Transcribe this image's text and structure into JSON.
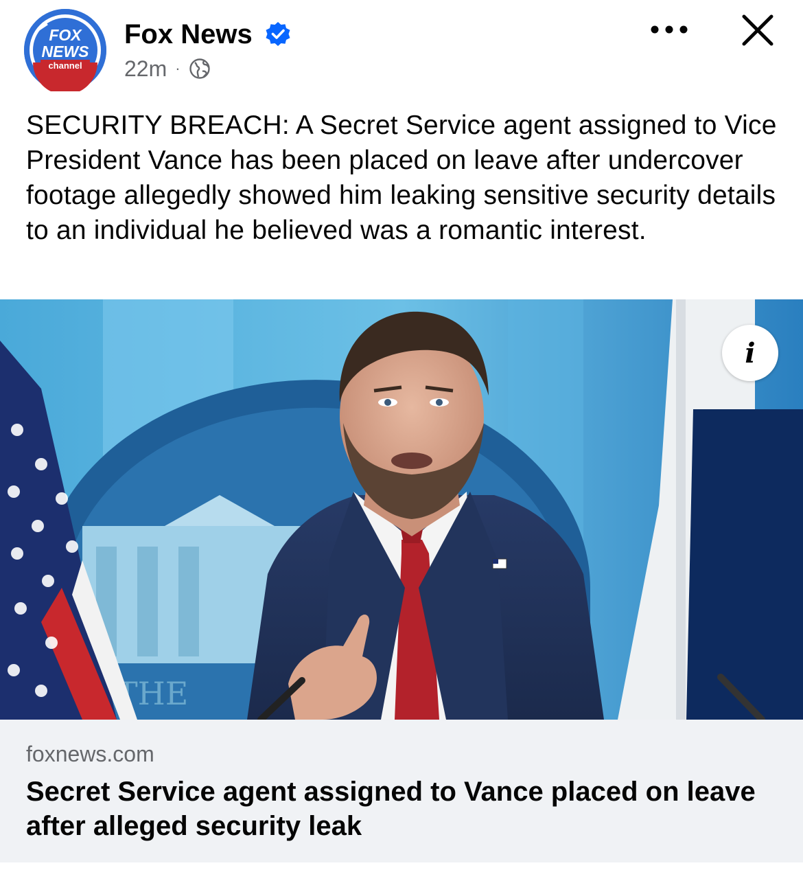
{
  "post": {
    "author": {
      "name": "Fox News",
      "avatar_text_top": "FOX",
      "avatar_text_mid": "NEWS",
      "avatar_text_bottom": "channel",
      "verified": true
    },
    "time": "22m",
    "separator": "·",
    "audience_icon": "globe-icon",
    "text": "SECURITY BREACH: A Secret Service agent assigned to Vice President Vance has been placed on leave after undercover footage allegedly showed him leaking sensitive security details to an individual he believed was a romantic interest."
  },
  "photo": {
    "podium_text": "THE",
    "info_label": "i"
  },
  "link": {
    "domain": "foxnews.com",
    "title": "Secret Service agent assigned to Vance placed on leave after alleged security leak"
  },
  "icons": {
    "more": "more-horizontal-icon",
    "close": "close-icon",
    "verified": "verified-badge-icon",
    "info": "info-icon"
  },
  "colors": {
    "verified_blue": "#0866ff",
    "meta_gray": "#65676b",
    "card_bg": "#f0f2f5",
    "fox_blue": "#2f6fd6",
    "fox_red": "#c8282d"
  }
}
